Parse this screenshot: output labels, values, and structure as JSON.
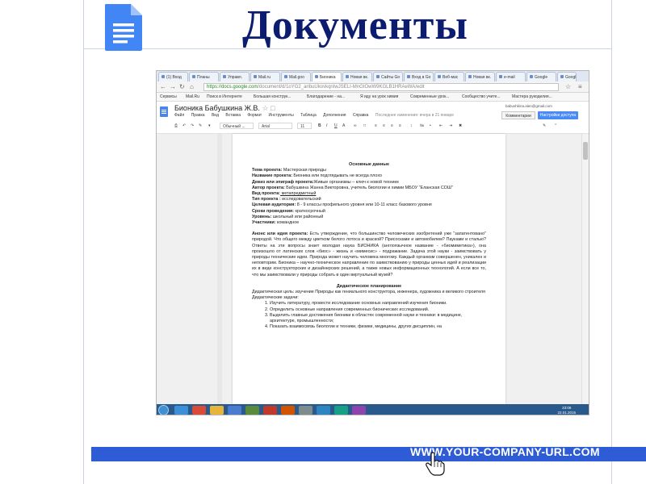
{
  "slide": {
    "title": "Документы",
    "footer_url": "WWW.YOUR-COMPANY-URL.COM"
  },
  "browser": {
    "tabs": [
      "(1) Вход",
      "Планы",
      "Управл.",
      "Mail.ru",
      "Mail.goo",
      "Бионика",
      "Новая вк.",
      "Сайты Go",
      "Вход в Go",
      "Веб-мас",
      "Новая вк.",
      "е-mail",
      "Google",
      "Google"
    ],
    "active_tab_index": 6,
    "url_main": "https://docs.google.com",
    "url_rest": "/document/d/1oYG2_aribuUkovkqnIwJSELI-MnGtOwW9KGLB1HRAeWA/edit",
    "bookmarks": [
      "Сервисы",
      "Mail.Ru",
      "Поиск в Интернете",
      "Большая конструк...",
      "Благодарение - на...",
      "Я иду на урок химия",
      "Современные урок...",
      "Сообщество учите...",
      "Мастера рукоделия..."
    ]
  },
  "gdocs": {
    "doc_title": "Бионика Бабушкина Ж.В.",
    "menu": [
      "Файл",
      "Правка",
      "Вид",
      "Вставка",
      "Формат",
      "Инструменты",
      "Таблица",
      "Дополнения",
      "Справка"
    ],
    "last_edit": "Последнее изменение: вчера в 21 январе",
    "account": "babushkina.alen@gmail.com",
    "comments_label": "Комментарии",
    "share_label": "Настройки доступа",
    "style_value": "Обычный ...",
    "font_value": "Arial",
    "size_value": "11"
  },
  "document": {
    "heading": "Основные данные",
    "fields": [
      {
        "label": "Тема проекта:",
        "value": " Мастерская природы"
      },
      {
        "label": "Название проекта:",
        "value": " Бионика или подглядывать не всегда плохо"
      },
      {
        "label": "Девиз или эпиграф проекта:",
        "value": "Живые организмы – ключ к новой технике"
      },
      {
        "label": "Автор проекта:",
        "value": " Бабушкина Жанна Викторовна, учитель биологии и химии МБОУ \"Еланская СОШ\""
      },
      {
        "label": "Вид проекта:",
        "value": " метапредметный"
      },
      {
        "label": "Тип проекта :",
        "value": " исследовательский"
      },
      {
        "label": "Целевая аудитория:",
        "value": "  8 - 9 классы профильного уровня или 10-11 класс базового уровня"
      },
      {
        "label": "Сроки проведения:",
        "value": " краткосрочный"
      },
      {
        "label": "Уровень:",
        "value": " школьный или районный"
      },
      {
        "label": "Участники:",
        "value": " командное"
      }
    ],
    "annotation_label": "Анонс или идея проекта:",
    "annotation_text": " Есть утверждение, что большинство человеческих изобретений уже \"запатентовано\" природой. Что общего между цветком белого лотоса и краской? Присосками и автомобилем? Пауками и сталью? Ответы на эти вопросы знает молодая наука БИОНИКА (англоязычное название - «биомиметика»), она произошло от латинских слов «биос» - жизнь и «мимесис» - подражание. Задача этой науки - заимствовать у природы технические идеи. Природа может научить человека многому. Каждый организм совершенен, уникален и неповторим. Бионика – научно-техническое направление по заимствованию у природы ценных идей и реализации их в виде конструкторских и дизайнерских решений, а также новых информационных технологий. А если все то, что мы заимствовали у природы собрать в один виртуальный музей?",
    "didactic_heading": "Дидактическое планирование",
    "didactic_goal": "Дидактическая цель: изучение Природы как гениального конструктора, инженера, художника и великого строителя",
    "didactic_tasks_label": "Дидактические задачи:",
    "tasks": [
      "Изучить литературу, провести исследование основных направлений изучения бионики.",
      "Определить основные направления современных бионических исследований.",
      "Выделить главные достижения бионики в областях современной науки и техники: в медицине, архитектуре, промышленности;",
      "Показать взаимосвязь биологии и техники, физики, медицины, других дисциплин, на"
    ]
  },
  "taskbar": {
    "time": "23:06",
    "date": "22.01.2015"
  },
  "colors": {
    "title": "#0c1c6e",
    "footer_bar": "#2d5cd6",
    "share_button": "#4a8af4",
    "taskbar": "#2a5a8c"
  }
}
